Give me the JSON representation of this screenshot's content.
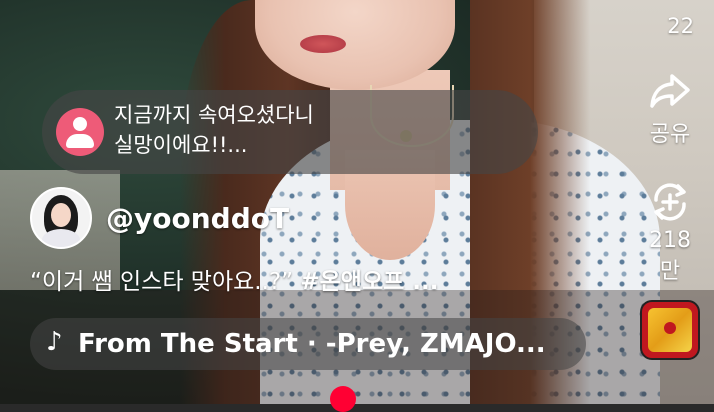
{
  "comment": {
    "text": "지금까지 속여오셨다니\n실망이에요!!..."
  },
  "channel": {
    "handle": "@yoonddoT"
  },
  "video": {
    "title_prefix": "“이거 쌤 인스타 맞아요..?” ",
    "title_tag": "#온앤오프 ..."
  },
  "music": {
    "note": "♪",
    "label": "From The Start · -Prey, ZMAJO..."
  },
  "actions": {
    "top_count": "22",
    "share_label": "공유",
    "remix_count": "218만"
  },
  "colors": {
    "accent": "#ff0033",
    "avatar_placeholder": "#ee5b78"
  },
  "icons": {
    "share": "share-arrow-icon",
    "remix": "remix-icon",
    "music": "music-note-icon"
  }
}
